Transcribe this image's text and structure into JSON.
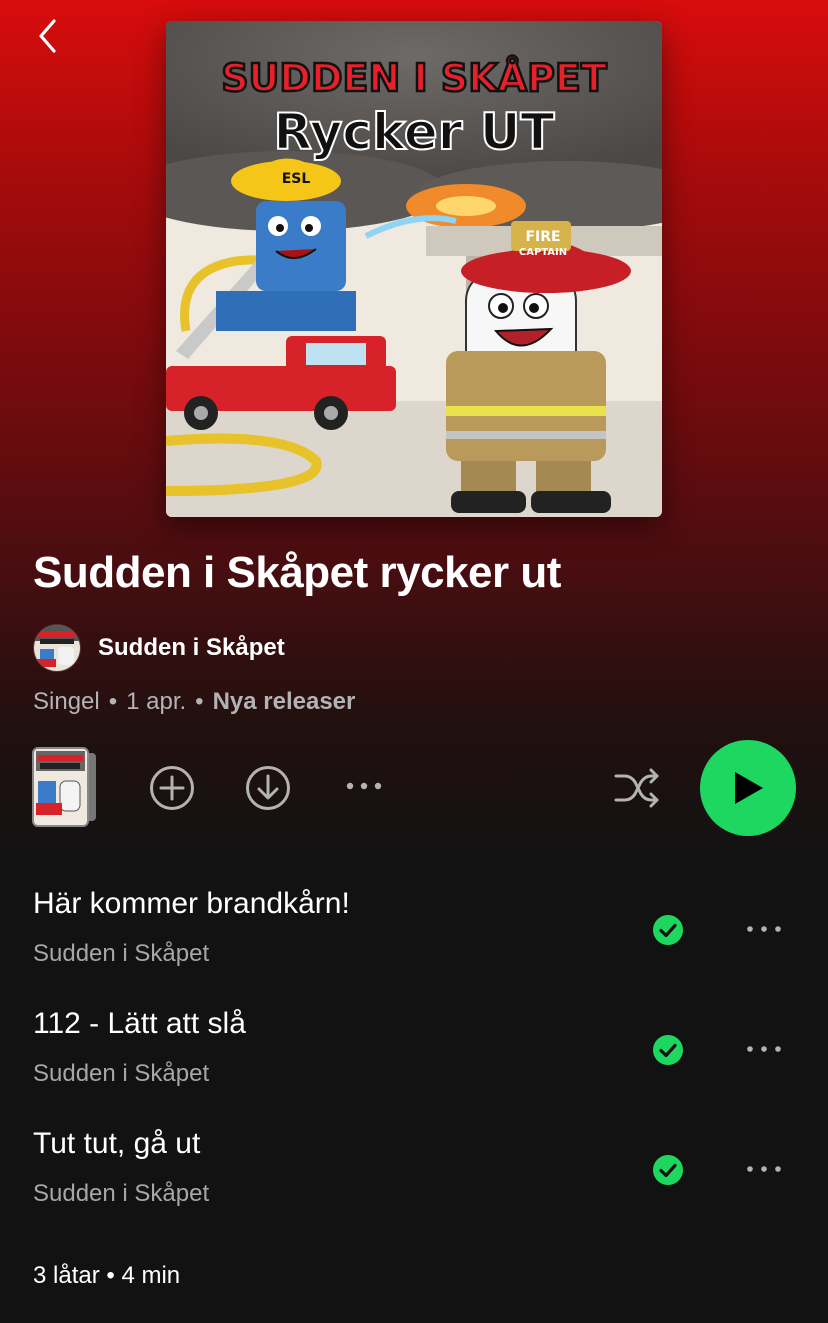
{
  "album": {
    "title": "Sudden i Skåpet rycker ut",
    "cover_title_top": "SUDDEN I SKÅPET",
    "cover_title_bottom": "Rycker UT",
    "cover_helmet_left": "ESL",
    "cover_helmet_right_1": "FIRE",
    "cover_helmet_right_2": "CAPTAIN"
  },
  "artist": {
    "name": "Sudden i Skåpet"
  },
  "meta": {
    "type": "Singel",
    "separator": "•",
    "date": "1 apr.",
    "label": "Nya releaser"
  },
  "icons": {
    "back": "chevron-left-icon",
    "add": "plus-circle-icon",
    "download": "download-circle-icon",
    "more": "more-horizontal-icon",
    "shuffle": "shuffle-icon",
    "play": "play-icon",
    "downloaded": "check-circle-icon"
  },
  "colors": {
    "accent": "#1ed760",
    "header_red": "#d80c0c",
    "background": "#121212",
    "secondary_text": "#a7a7a7"
  },
  "tracks": [
    {
      "title": "Här kommer brandkårn!",
      "artist": "Sudden i Skåpet",
      "downloaded": true
    },
    {
      "title": "112 - Lätt att slå",
      "artist": "Sudden i Skåpet",
      "downloaded": true
    },
    {
      "title": "Tut tut, gå ut",
      "artist": "Sudden i Skåpet",
      "downloaded": true
    }
  ],
  "summary": "3 låtar • 4 min"
}
